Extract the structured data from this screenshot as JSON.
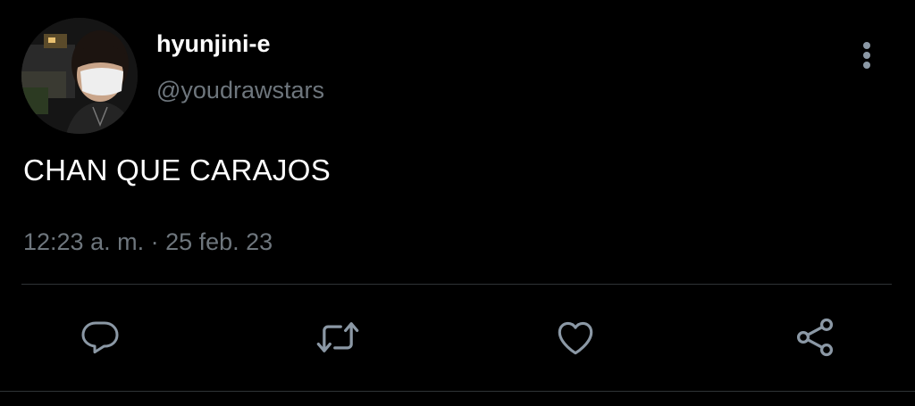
{
  "user": {
    "display_name": "hyunjini-e",
    "handle": "@youdrawstars"
  },
  "tweet": {
    "text": "CHAN QUE CARAJOS",
    "timestamp": "12:23 a. m. · 25 feb. 23"
  },
  "icons": {
    "more": "more-vertical-icon",
    "reply": "reply-icon",
    "retweet": "retweet-icon",
    "like": "heart-icon",
    "share": "share-icon"
  },
  "colors": {
    "background": "#000000",
    "primary_text": "#ffffff",
    "secondary_text": "#6e767d",
    "icon": "#8b98a5",
    "divider": "#2f3336"
  }
}
